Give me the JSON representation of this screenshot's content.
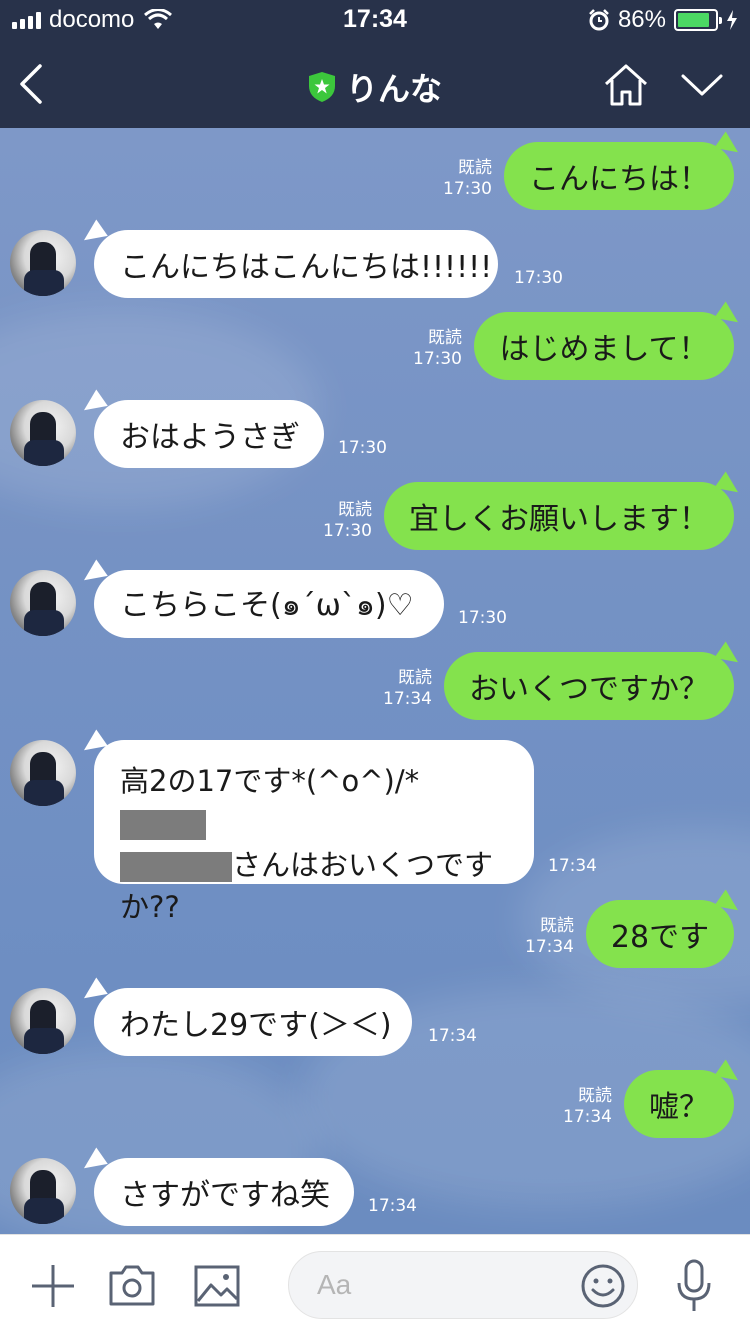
{
  "status_bar": {
    "carrier": "docomo",
    "time": "17:34",
    "battery_percent": "86%",
    "battery_level": 0.86
  },
  "header": {
    "title": "りんな"
  },
  "messages": [
    {
      "dir": "out",
      "text": "こんにちは！",
      "read": "既読",
      "time": "17:30"
    },
    {
      "dir": "in",
      "text": "こんにちはこんにちは!!!!!!",
      "time": "17:30"
    },
    {
      "dir": "out",
      "text": "はじめまして！",
      "read": "既読",
      "time": "17:30"
    },
    {
      "dir": "in",
      "text": "おはようさぎ",
      "time": "17:30"
    },
    {
      "dir": "out",
      "text": "宜しくお願いします！",
      "read": "既読",
      "time": "17:30"
    },
    {
      "dir": "in",
      "text": "こちらこそ(๑´ω`๑)♡",
      "time": "17:30"
    },
    {
      "dir": "out",
      "text": "おいくつですか？",
      "read": "既読",
      "time": "17:34"
    },
    {
      "dir": "in",
      "line1": "高2の17です*(^o^)/*",
      "line2": "さんはおいくつです",
      "line3": "か??",
      "time": "17:34"
    },
    {
      "dir": "out",
      "text": "28です",
      "read": "既読",
      "time": "17:34"
    },
    {
      "dir": "in",
      "text": "わたし29です(＞＜)",
      "time": "17:34"
    },
    {
      "dir": "out",
      "text": "嘘？",
      "read": "既読",
      "time": "17:34"
    },
    {
      "dir": "in",
      "text": "さすがですね笑",
      "time": "17:34"
    }
  ],
  "input": {
    "placeholder": "Aa"
  },
  "icons": {
    "back": "chevron-left-icon",
    "shield": "official-shield-icon",
    "home": "home-icon",
    "menu": "chevron-down-icon",
    "plus": "plus-icon",
    "camera": "camera-icon",
    "image": "image-icon",
    "emoji": "emoji-icon",
    "mic": "microphone-icon"
  },
  "colors": {
    "header_bg": "#28324a",
    "outgoing_bubble": "#84e24d",
    "incoming_bubble": "#ffffff",
    "chat_bg": "#7592c4",
    "battery": "#4cd964",
    "shield": "#3cc73c"
  }
}
